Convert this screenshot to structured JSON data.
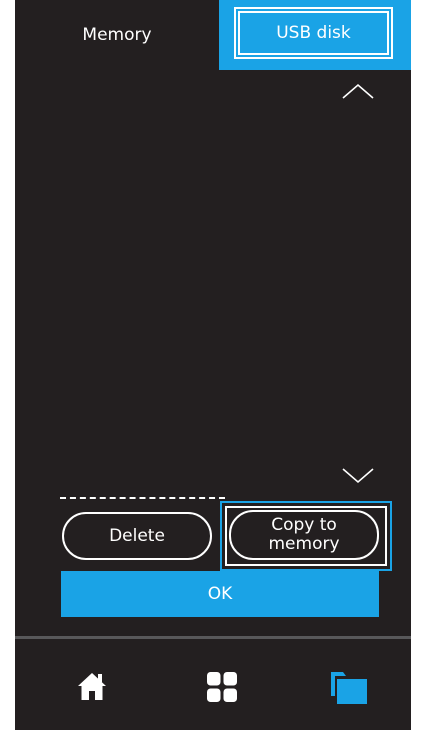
{
  "tabs": {
    "memory_label": "Memory",
    "usb_label": "USB disk",
    "active": "usb"
  },
  "icons": {
    "scroll_up": "chevron-up-icon",
    "scroll_down": "chevron-down-icon",
    "home": "home-icon",
    "grid": "grid-icon",
    "files": "folder-icon"
  },
  "actions": {
    "delete_label": "Delete",
    "copy_line1": "Copy to",
    "copy_line2": "memory",
    "ok_label": "OK"
  },
  "colors": {
    "accent": "#1aa3e6",
    "background": "#231f20",
    "text": "#ffffff"
  }
}
